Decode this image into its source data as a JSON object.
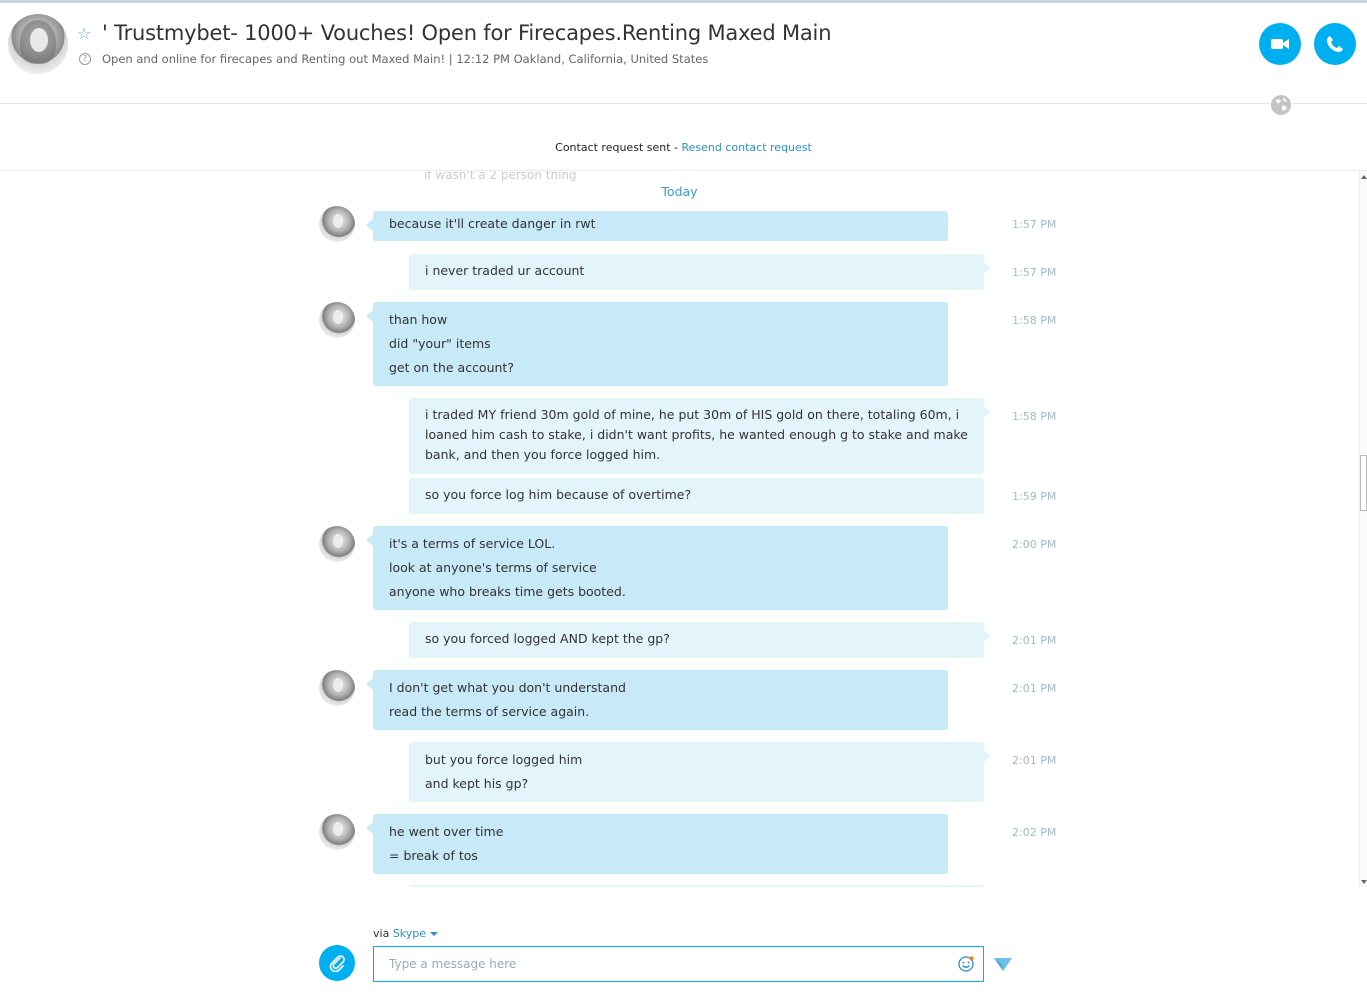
{
  "header": {
    "title": "' Trustmybet- 1000+ Vouches! Open for Firecapes.Renting Maxed Main",
    "mood": "Open and online for firecapes and Renting out Maxed Main!  |  12:12 PM Oakland, California, United States",
    "icons": {
      "favorite": "star-icon",
      "help": "help-icon",
      "video": "video-camera-icon",
      "call": "phone-icon",
      "globe": "globe-icon"
    }
  },
  "contact_request": {
    "text": "Contact request sent - ",
    "link": "Resend contact request"
  },
  "conversation": {
    "ghost_text": "if wasn't a 2 person thing",
    "day_label": "Today",
    "messages": [
      {
        "from": "them",
        "time": "1:57 PM",
        "lines": [
          "because it'll create danger in rwt"
        ]
      },
      {
        "from": "me",
        "time": "1:57 PM",
        "lines": [
          "i never traded ur account"
        ]
      },
      {
        "from": "them",
        "time": "1:58 PM",
        "lines": [
          "than how",
          "did \"your\" items",
          "get on the account?"
        ]
      },
      {
        "from": "me",
        "time": "1:58 PM",
        "lines": [
          "i traded MY friend 30m gold of mine, he put 30m of HIS gold on there, totaling 60m, i loaned him cash to stake, i didn't want profits, he wanted enough g to stake and make bank, and then you force logged him."
        ]
      },
      {
        "from": "me",
        "time": "1:59 PM",
        "lines": [
          "so you force log him because of overtime?"
        ]
      },
      {
        "from": "them",
        "time": "2:00 PM",
        "lines": [
          "it's a terms of service LOL.",
          "look at anyone's terms of service",
          "anyone who breaks time gets booted."
        ]
      },
      {
        "from": "me",
        "time": "2:01 PM",
        "lines": [
          "so you forced logged AND kept the gp?"
        ]
      },
      {
        "from": "them",
        "time": "2:01 PM",
        "lines": [
          "I don't get what you don't understand",
          "read the terms of service again."
        ]
      },
      {
        "from": "me",
        "time": "2:01 PM",
        "lines": [
          "but you force logged him",
          "and kept his gp?"
        ]
      },
      {
        "from": "them",
        "time": "2:02 PM",
        "lines": [
          "he went over time",
          "= break of tos"
        ]
      }
    ]
  },
  "compose": {
    "via_label": "via ",
    "service": "Skype",
    "placeholder": "Type a message here",
    "icons": {
      "attach": "paperclip-icon",
      "emoji": "emoji-icon",
      "send": "send-icon"
    }
  },
  "colors": {
    "accent": "#00aff0",
    "their_bubble": "#c7e9f8",
    "my_bubble": "#e4f4fb",
    "timestamp": "#a2b9c9",
    "link": "#2b8fd0"
  }
}
